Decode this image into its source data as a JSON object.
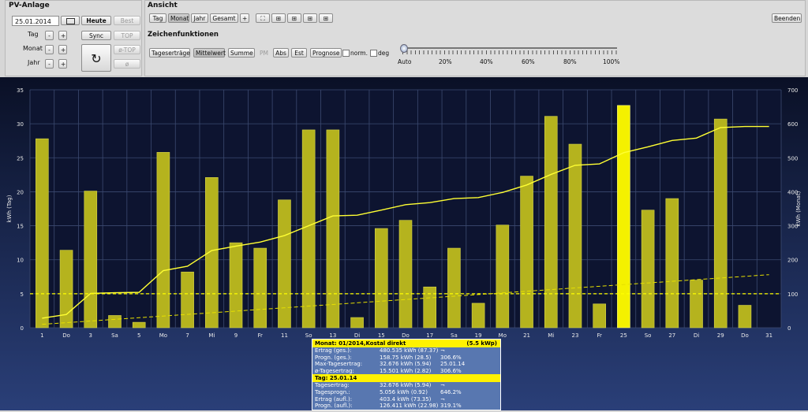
{
  "pv": {
    "title": "PV-Anlage",
    "date": "25.01.2014",
    "today_label": "Heute",
    "best_label": "Best",
    "sync_label": "Sync",
    "top_label": "TOP",
    "atop_label": "ø-TOP",
    "sigma_label": "ø",
    "row_labels": [
      "Tag",
      "Monat",
      "Jahr"
    ],
    "minus": "-",
    "plus": "+"
  },
  "view": {
    "title": "Ansicht",
    "tabs": [
      "Tag",
      "Monat",
      "Jahr",
      "Gesamt",
      "+"
    ],
    "exit_label": "Beenden",
    "draw_title": "Zeichenfunktionen",
    "draw_buttons": [
      "Tageserträge",
      "Mittelwert",
      "Summe",
      "PM",
      "Abs",
      "Est",
      "Prognose"
    ],
    "check_labels": [
      "norm.",
      "deg"
    ],
    "slider_labels": [
      "Auto",
      "20%",
      "40%",
      "60%",
      "80%",
      "100%"
    ],
    "slider_value": 0
  },
  "chart_data": {
    "type": "bar",
    "ylabel": "kWh (Tag)",
    "y2label": "kWh (Monat)",
    "ylim": [
      0,
      35
    ],
    "y2lim": [
      0,
      700
    ],
    "yticks": [
      "0",
      "5",
      "10",
      "15",
      "20",
      "25",
      "30",
      "35"
    ],
    "y2ticks": [
      "0",
      "100",
      "200",
      "300",
      "400",
      "500",
      "600",
      "700"
    ],
    "categories": [
      "1",
      "Do",
      "3",
      "Sa",
      "5",
      "Mo",
      "7",
      "Mi",
      "9",
      "Fr",
      "11",
      "So",
      "13",
      "Di",
      "15",
      "Do",
      "17",
      "Sa",
      "19",
      "Mo",
      "21",
      "Mi",
      "23",
      "Fr",
      "25",
      "So",
      "27",
      "Di",
      "29",
      "Do",
      "31"
    ],
    "values": [
      27.8,
      11.4,
      20.1,
      1.8,
      0.8,
      25.8,
      8.2,
      22.1,
      12.5,
      11.7,
      18.8,
      29.1,
      29.1,
      1.5,
      14.6,
      15.8,
      6.0,
      11.7,
      3.6,
      15.1,
      22.3,
      31.1,
      27.0,
      3.5,
      32.7,
      17.3,
      19.0,
      7.0,
      30.7,
      3.3,
      0.0
    ],
    "highlight_index": 24,
    "cumulative": [
      28,
      39,
      101,
      103,
      104,
      168,
      181,
      227,
      240,
      252,
      271,
      300,
      329,
      331,
      346,
      362,
      368,
      380,
      383,
      398,
      420,
      451,
      478,
      482,
      515,
      532,
      551,
      558,
      589,
      592,
      592
    ],
    "average_line": 5.0,
    "forecast_line": [
      0.5,
      7.8
    ],
    "grid": true,
    "colors": {
      "bar": "#b5b31e",
      "bar_highlight": "#f4f100",
      "line": "#ffff33",
      "avg": "#ffff00"
    }
  },
  "tooltip": {
    "month_header": "Monat: 01/2014,Kostal direkt",
    "month_kwp": "(5.5 kWp)",
    "month_rows": [
      [
        "Ertrag (ges.):",
        "480.535 kWh (87.37)",
        "¬",
        ""
      ],
      [
        "Progn. (ges.):",
        "158.75 kWh (28.5)",
        "306.6%",
        ""
      ],
      [
        "Max-Tagesertrag:",
        "32.676 kWh (5.94)",
        "25.01.14",
        ""
      ],
      [
        "ø-Tagesertrag:",
        "15.501 kWh (2.82)",
        "306.6%",
        ""
      ]
    ],
    "day_header": "Tag: 25.01.14",
    "day_rows": [
      [
        "Tagesertrag:",
        "32.676 kWh (5.94)",
        "¬",
        ""
      ],
      [
        "Tagesprogn.:",
        "5.056 kWh (0.92)",
        "646.2%",
        ""
      ],
      [
        "Ertrag (aufl.):",
        "403.4 kWh (73.35)",
        "¬",
        ""
      ],
      [
        "Progn. (aufl.):",
        "126.411 kWh (22.98)",
        "319.1%",
        ""
      ]
    ]
  }
}
